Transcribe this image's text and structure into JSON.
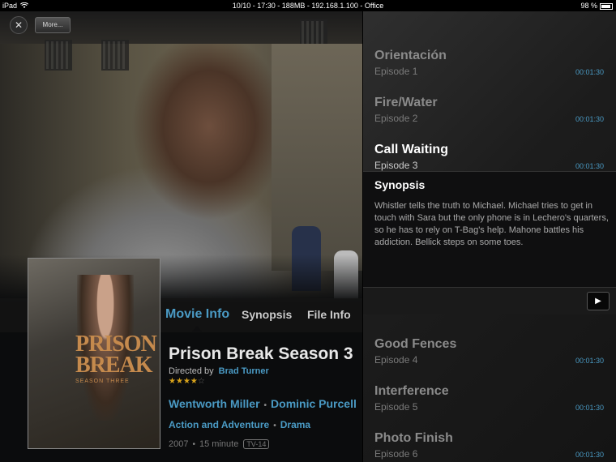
{
  "status": {
    "device": "iPad",
    "center": "10/10 - 17:30 - 188MB - 192.168.1.100 - Office",
    "battery": "98 %"
  },
  "toolbar": {
    "close_label": "✕",
    "more_label": "More..."
  },
  "tabs": [
    {
      "label": "Movie Info",
      "active": true
    },
    {
      "label": "Synopsis",
      "active": false
    },
    {
      "label": "File Info",
      "active": false
    }
  ],
  "poster": {
    "title_line1": "PRISON",
    "title_line2": "BREAK",
    "subtitle": "SEASON THREE"
  },
  "movie": {
    "title": "Prison Break Season 3",
    "directed_label": "Directed by",
    "director": "Brad Turner",
    "rating_stars": 4,
    "rating_max": 5,
    "actors": [
      "Wentworth Miller",
      "Dominic Purcell"
    ],
    "genres": [
      "Action and Adventure",
      "Drama"
    ],
    "year": "2007",
    "runtime": "15 minute",
    "content_rating": "TV-14"
  },
  "episodes": [
    {
      "name": "Orientación",
      "number": "Episode 1",
      "duration": "00:01:30"
    },
    {
      "name": "Fire/Water",
      "number": "Episode 2",
      "duration": "00:01:30"
    },
    {
      "name": "Call Waiting",
      "number": "Episode 3",
      "duration": "00:01:30"
    },
    {
      "name": "Good Fences",
      "number": "Episode 4",
      "duration": "00:01:30"
    },
    {
      "name": "Interference",
      "number": "Episode 5",
      "duration": "00:01:30"
    },
    {
      "name": "Photo Finish",
      "number": "Episode 6",
      "duration": "00:01:30"
    }
  ],
  "synopsis": {
    "heading": "Synopsis",
    "text": "Whistler tells the truth to Michael. Michael tries to get in touch with Sara but the only phone is in Lechero's quarters, so he has to rely on T-Bag's help. Mahone battles his addiction. Bellick steps on some toes.",
    "play_label": "▶"
  },
  "colors": {
    "accent": "#4a9ac4",
    "star": "#d8a31b",
    "panel_bg": "#1c1c1c"
  }
}
